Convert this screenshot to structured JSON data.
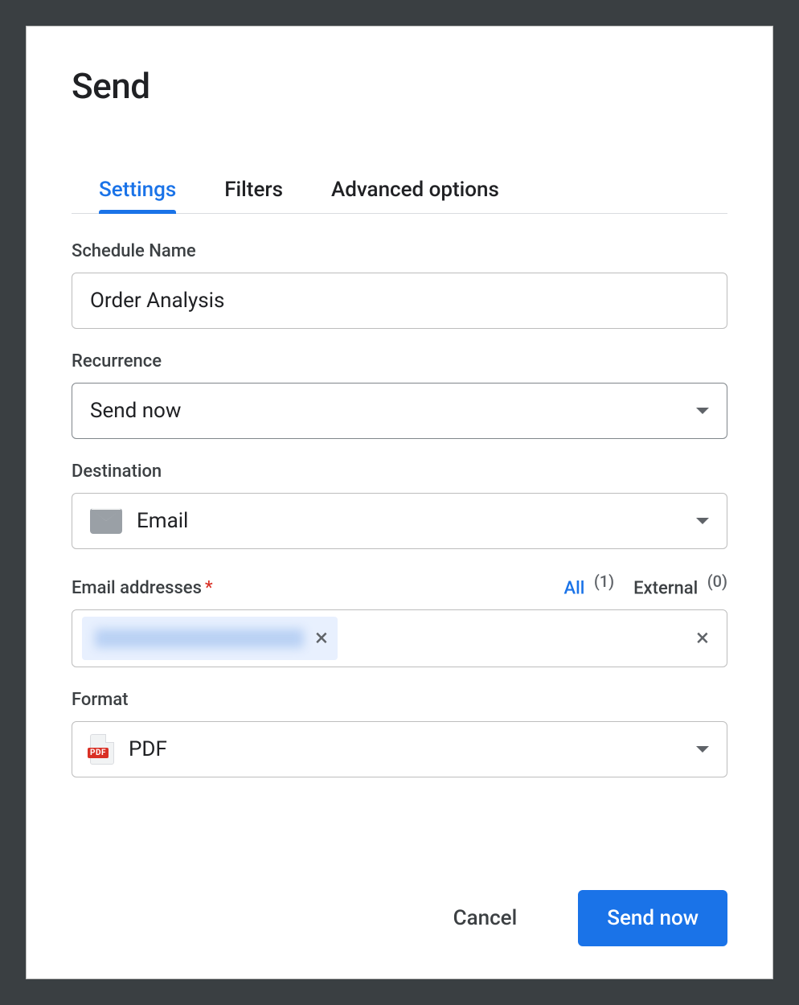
{
  "title": "Send",
  "tabs": [
    {
      "label": "Settings",
      "active": true
    },
    {
      "label": "Filters",
      "active": false
    },
    {
      "label": "Advanced options",
      "active": false
    }
  ],
  "fields": {
    "schedule_name": {
      "label": "Schedule Name",
      "value": "Order Analysis"
    },
    "recurrence": {
      "label": "Recurrence",
      "value": "Send now"
    },
    "destination": {
      "label": "Destination",
      "value": "Email",
      "icon": "mail-icon"
    },
    "email": {
      "label": "Email addresses",
      "required": true,
      "filters": {
        "all": {
          "label": "All",
          "count": 1,
          "active": true
        },
        "external": {
          "label": "External",
          "count": 0,
          "active": false
        }
      },
      "chips": [
        {
          "text_redacted": true
        }
      ]
    },
    "format": {
      "label": "Format",
      "value": "PDF",
      "icon": "pdf-icon"
    }
  },
  "footer": {
    "cancel": "Cancel",
    "submit": "Send now"
  }
}
